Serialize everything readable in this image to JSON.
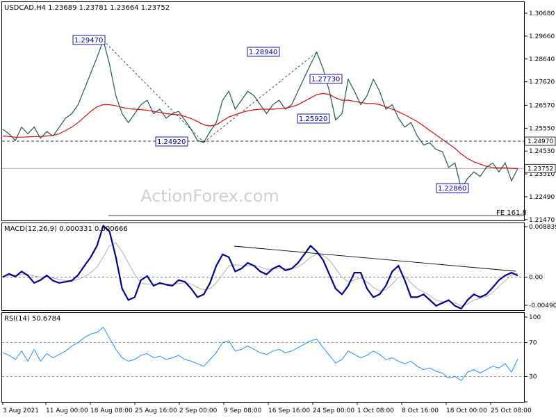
{
  "chart_data": [
    {
      "type": "line",
      "title": "USDCAD,H4  1.23689 1.23781 1.23664 1.23752",
      "symbol": "USDCAD",
      "timeframe": "H4",
      "ohlc": {
        "open": 1.23689,
        "high": 1.23781,
        "low": 1.23664,
        "close": 1.23752
      },
      "y_ticks": [
        "1.30680",
        "1.29660",
        "1.28640",
        "1.27620",
        "1.26570",
        "1.25550",
        "1.24530",
        "1.23510",
        "1.22490",
        "1.21470"
      ],
      "ylim": [
        1.2147,
        1.3068
      ],
      "x_labels": [
        "3 Aug 2021",
        "11 Aug 00:00",
        "18 Aug 08:00",
        "25 Aug 16:00",
        "2 Sep 00:00",
        "9 Sep 08:00",
        "16 Sep 16:00",
        "24 Sep 00:00",
        "1 Oct 08:00",
        "8 Oct 16:00",
        "18 Oct 00:00",
        "25 Oct 08:00"
      ],
      "series": [
        {
          "name": "",
          "values": [
            1.255,
            1.253,
            1.25,
            1.256,
            1.253,
            1.256,
            1.251,
            1.254,
            1.252,
            1.256,
            1.26,
            1.262,
            1.266,
            1.273,
            1.28,
            1.287,
            1.2947,
            1.284,
            1.27,
            1.262,
            1.258,
            1.262,
            1.266,
            1.268,
            1.262,
            1.264,
            1.26,
            1.262,
            1.263,
            1.259,
            1.255,
            1.25,
            1.2492,
            1.254,
            1.258,
            1.268,
            1.272,
            1.264,
            1.268,
            1.272,
            1.27,
            1.266,
            1.262,
            1.266,
            1.268,
            1.264,
            1.266,
            1.272,
            1.278,
            1.284,
            1.2894,
            1.282,
            1.272,
            1.2592,
            1.262,
            1.2773,
            1.272,
            1.266,
            1.27,
            1.2773,
            1.272,
            1.264,
            1.266,
            1.26,
            1.256,
            1.258,
            1.252,
            1.248,
            1.249,
            1.246,
            1.245,
            1.238,
            1.24,
            1.2286,
            1.233,
            1.236,
            1.234,
            1.238,
            1.24,
            1.236,
            1.24,
            1.232,
            1.2375
          ]
        },
        {
          "name": "",
          "values": [
            1.252,
            1.2518,
            1.2515,
            1.2515,
            1.2516,
            1.2518,
            1.2518,
            1.252,
            1.2523,
            1.253,
            1.2545,
            1.256,
            1.258,
            1.2605,
            1.263,
            1.265,
            1.266,
            1.266,
            1.2655,
            1.2648,
            1.2642,
            1.264,
            1.2638,
            1.2635,
            1.263,
            1.2625,
            1.262,
            1.2617,
            1.2615,
            1.2608,
            1.2598,
            1.2585,
            1.257,
            1.2565,
            1.257,
            1.2588,
            1.2605,
            1.2615,
            1.2625,
            1.2632,
            1.2637,
            1.264,
            1.264,
            1.264,
            1.2642,
            1.2645,
            1.265,
            1.266,
            1.2675,
            1.269,
            1.2705,
            1.271,
            1.2705,
            1.269,
            1.268,
            1.268,
            1.2675,
            1.267,
            1.2665,
            1.2665,
            1.266,
            1.265,
            1.264,
            1.2628,
            1.2615,
            1.26,
            1.2585,
            1.2565,
            1.2545,
            1.2525,
            1.2505,
            1.2485,
            1.2465,
            1.244,
            1.242,
            1.2405,
            1.2395,
            1.2385,
            1.238,
            1.2378,
            1.2378,
            1.2376,
            1.2375
          ]
        }
      ],
      "annotations": [
        "1.29470",
        "1.24920",
        "1.28940",
        "1.25920",
        "1.27730",
        "1.22860"
      ],
      "level_lines": [
        {
          "label": "1.24970",
          "value": 1.2497
        },
        {
          "label": "1.23752",
          "value": 1.23752
        }
      ],
      "fib_label": "FE 161.8",
      "watermark": "ActionForex.com"
    },
    {
      "type": "line",
      "title": "MACD(12,26,9) 0.000331 0.000666",
      "y_ticks": [
        "0.008839",
        "0.00",
        "-0.004907"
      ],
      "ylim": [
        -0.004907,
        0.008839
      ],
      "series": [
        {
          "name": "",
          "values": [
            0.0,
            0.0006,
            0.0001,
            0.001,
            0.0003,
            -0.001,
            -0.0005,
            0.0003,
            -0.0006,
            -0.001,
            -0.0008,
            -0.0006,
            0.0004,
            0.002,
            0.0035,
            0.0055,
            0.009,
            0.008,
            0.0035,
            -0.002,
            -0.004,
            -0.0035,
            -0.0005,
            0.0002,
            -0.0015,
            -0.001,
            -0.0013,
            -0.0015,
            -0.0005,
            -0.0008,
            -0.002,
            -0.0035,
            -0.003,
            -0.001,
            0.002,
            0.004,
            0.0035,
            0.001,
            0.0015,
            0.0025,
            0.002,
            0.001,
            0.0005,
            0.0015,
            0.002,
            0.0012,
            0.0015,
            0.0025,
            0.004,
            0.0055,
            0.0045,
            0.003,
            0.0005,
            -0.002,
            -0.003,
            -0.0015,
            0.0008,
            0.0008,
            -0.002,
            -0.0035,
            -0.003,
            -0.0015,
            0.001,
            0.002,
            -0.0005,
            -0.0035,
            -0.0035,
            -0.003,
            -0.004,
            -0.005,
            -0.0045,
            -0.004,
            -0.005,
            -0.0055,
            -0.004,
            -0.003,
            -0.0035,
            -0.003,
            -0.0018,
            -0.0005,
            0.0003,
            0.0008,
            0.0003
          ]
        },
        {
          "name": "",
          "values": [
            0.0002,
            0.0003,
            0.0003,
            0.0005,
            0.0005,
            0.0002,
            0.0,
            0.0001,
            -0.0001,
            -0.0004,
            -0.0006,
            -0.0006,
            -0.0004,
            0.0001,
            0.0008,
            0.0018,
            0.0035,
            0.0055,
            0.006,
            0.0045,
            0.0025,
            0.0005,
            -0.001,
            -0.0012,
            -0.0012,
            -0.0012,
            -0.0012,
            -0.0013,
            -0.0011,
            -0.001,
            -0.0012,
            -0.0018,
            -0.0022,
            -0.002,
            -0.001,
            0.0005,
            0.002,
            0.0022,
            0.002,
            0.002,
            0.0021,
            0.0018,
            0.0014,
            0.0014,
            0.0016,
            0.0015,
            0.0015,
            0.0018,
            0.0025,
            0.0035,
            0.004,
            0.0038,
            0.003,
            0.0015,
            0.0,
            -0.0008,
            -0.0005,
            -0.0001,
            -0.0008,
            -0.0018,
            -0.0024,
            -0.0022,
            -0.0012,
            0.0,
            0.0002,
            -0.001,
            -0.002,
            -0.0026,
            -0.0032,
            -0.004,
            -0.0043,
            -0.0042,
            -0.0045,
            -0.005,
            -0.0047,
            -0.004,
            -0.0037,
            -0.0034,
            -0.0027,
            -0.0016,
            -0.0006,
            0.0004,
            0.0007
          ]
        }
      ],
      "trendline_label": ""
    },
    {
      "type": "line",
      "title": "RSI(14) 50.6784",
      "y_ticks": [
        "100",
        "70",
        "30",
        "0"
      ],
      "ylim": [
        0,
        100
      ],
      "series": [
        {
          "name": "",
          "values": [
            58,
            55,
            50,
            60,
            48,
            62,
            48,
            57,
            52,
            56,
            60,
            66,
            70,
            76,
            80,
            82,
            88,
            75,
            62,
            52,
            48,
            50,
            55,
            57,
            52,
            54,
            50,
            52,
            55,
            50,
            48,
            45,
            42,
            50,
            58,
            70,
            72,
            60,
            62,
            66,
            62,
            58,
            56,
            60,
            62,
            58,
            60,
            64,
            68,
            72,
            74,
            64,
            55,
            46,
            50,
            60,
            56,
            52,
            55,
            60,
            56,
            50,
            52,
            48,
            45,
            48,
            42,
            38,
            40,
            36,
            34,
            28,
            30,
            25,
            35,
            38,
            34,
            38,
            42,
            40,
            45,
            35,
            50.6784
          ]
        }
      ]
    }
  ]
}
